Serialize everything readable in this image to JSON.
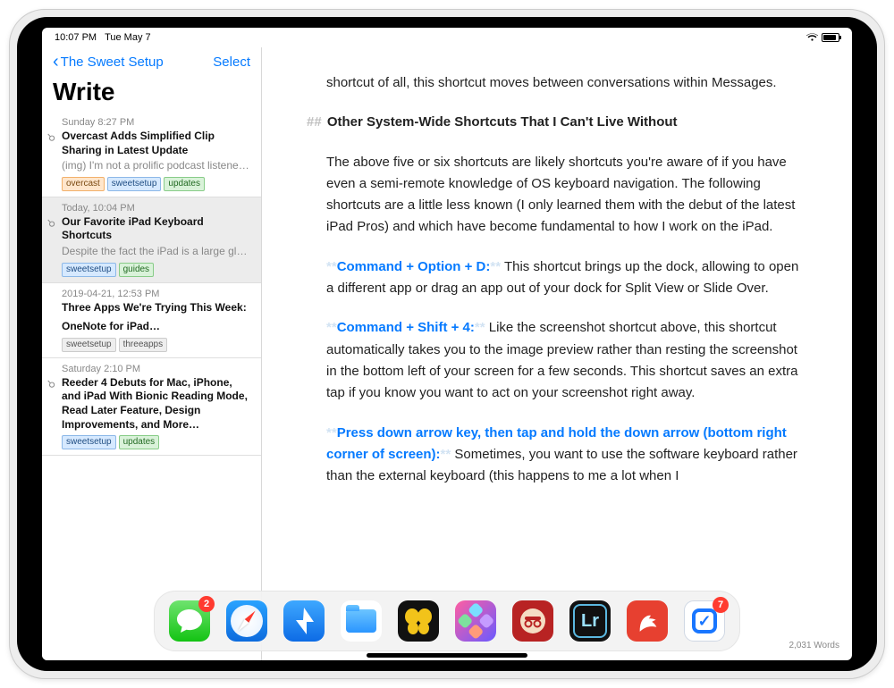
{
  "status": {
    "time": "10:07 PM",
    "date": "Tue May 7"
  },
  "sidebar": {
    "back_label": "The Sweet Setup",
    "select_label": "Select",
    "title": "Write",
    "notes": [
      {
        "date": "Sunday 8:27 PM",
        "title": "Overcast Adds Simplified Clip Sharing in Latest Update",
        "preview": "(img) I'm not a prolific podcast listener, but it…",
        "clip": true,
        "tags": [
          {
            "t": "overcast",
            "c": "orange"
          },
          {
            "t": "sweetsetup",
            "c": "blue"
          },
          {
            "t": "updates",
            "c": "green"
          }
        ]
      },
      {
        "date": "Today, 10:04 PM",
        "title": "Our Favorite iPad Keyboard Shortcuts",
        "preview": "Despite the fact the iPad is a large glowing touchscreen, it almost feels like it was built to…",
        "clip": true,
        "selected": true,
        "tags": [
          {
            "t": "sweetsetup",
            "c": "blue"
          },
          {
            "t": "guides",
            "c": "green"
          }
        ]
      },
      {
        "date": "2019-04-21, 12:53 PM",
        "title": "Three Apps We're Trying This Week:",
        "preview2": "OneNote for iPad…",
        "clip": false,
        "tags": [
          {
            "t": "sweetsetup",
            "c": "gray"
          },
          {
            "t": "threeapps",
            "c": "gray"
          }
        ]
      },
      {
        "date": "Saturday 2:10 PM",
        "title": "Reeder 4 Debuts for Mac, iPhone, and iPad With Bionic Reading Mode, Read Later Feature, Design Improvements, and More…",
        "preview": "",
        "clip": true,
        "tags": [
          {
            "t": "sweetsetup",
            "c": "blue"
          },
          {
            "t": "updates",
            "c": "green"
          }
        ]
      }
    ]
  },
  "editor": {
    "lead": "shortcut of all, this shortcut moves between conversations within Messages.",
    "section_title": "Other System-Wide Shortcuts That I Can't Live Without",
    "intro": "The above five or six shortcuts are likely shortcuts you're aware of if you have even a semi-remote knowledge of OS keyboard navigation. The following shortcuts are a little less known (I only learned them with the debut of the latest iPad Pros) and which have become fundamental to how I work on the iPad.",
    "sc1_title": "Command + Option + D:",
    "sc1_body": " This shortcut brings up the dock, allowing to open a different app or drag an app out of your dock for Split View or Slide Over.",
    "sc2_title": "Command + Shift + 4:",
    "sc2_body": " Like the screenshot shortcut above, this shortcut automatically takes you to the image preview rather than resting the screenshot in the bottom left of your screen for a few seconds. This shortcut saves an extra tap if you know you want to act on your screenshot right away.",
    "sc3_title": "Press down arrow key, then tap and hold the down arrow (bottom right corner of screen):",
    "sc3_body": " Sometimes, you want to use the software keyboard rather than the external keyboard (this happens to me a lot when I",
    "word_count": "2,031 Words"
  },
  "dock": {
    "items": [
      {
        "name": "messages",
        "badge": "2"
      },
      {
        "name": "safari"
      },
      {
        "name": "spark-mail"
      },
      {
        "name": "files"
      },
      {
        "name": "butterfly-app"
      },
      {
        "name": "shortcuts"
      },
      {
        "name": "red-reader"
      },
      {
        "name": "lightroom"
      },
      {
        "name": "bear"
      },
      {
        "name": "things",
        "badge": "7"
      }
    ]
  }
}
